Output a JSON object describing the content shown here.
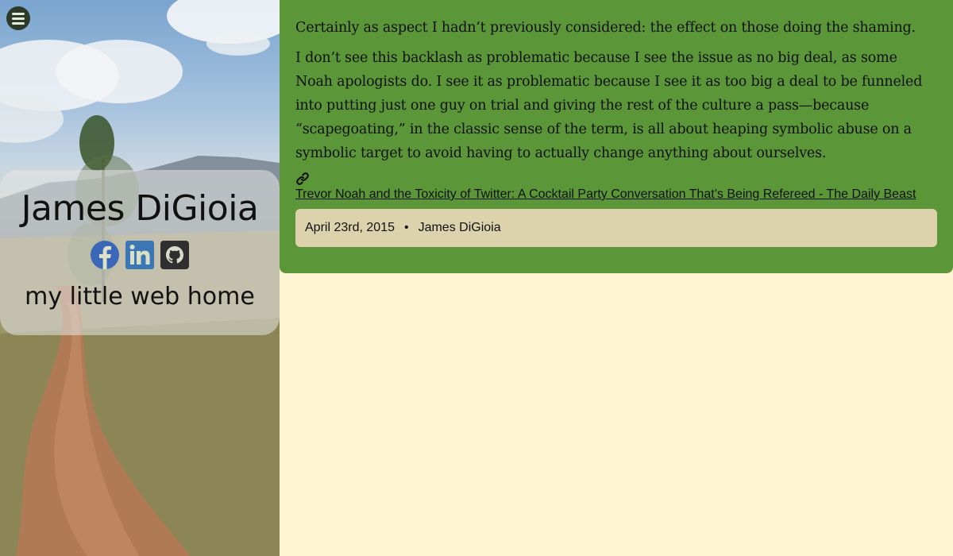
{
  "sidebar": {
    "site_title": "James DiGioia",
    "tagline": "my little web home",
    "social": [
      "facebook-icon",
      "linkedin-icon",
      "github-icon"
    ]
  },
  "post": {
    "paragraphs": [
      "Certainly as aspect I hadn’t previously considered: the effect on those doing the shaming.",
      "I don’t see this backlash as problematic because I see the issue as no big deal, as some Noah apologists do. I see it as problematic because I see it as too big a deal to be funneled into putting just one guy on trial and giving the rest of the culture a pass—because “scapegoating,” in the classic sense of the term, is all about heaping symbolic abuse on a symbolic target to avoid having to actually change anything about ourselves."
    ],
    "source_link": "Trevor Noah and the Toxicity of Twitter: A Cocktail Party Conversation That’s Being Refereed - The Daily Beast",
    "date": "April 23rd, 2015",
    "separator": "•",
    "author": "James DiGioia"
  },
  "colors": {
    "page_bg": "#fff5d2",
    "card_bg": "#5b9639",
    "meta_bg": "#dcd3ad",
    "facebook": "#3b67b9",
    "linkedin": "#3b77b5",
    "github": "#2f2f2f"
  }
}
